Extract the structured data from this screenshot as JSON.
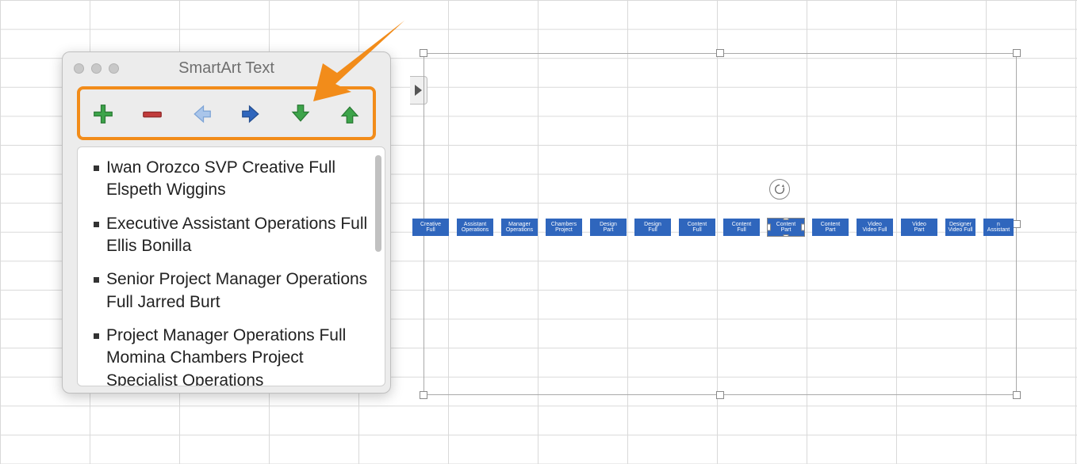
{
  "panel": {
    "title": "SmartArt Text",
    "toolbar": {
      "add": "add-shape",
      "remove": "remove-shape",
      "left": "promote-left",
      "right": "demote-right",
      "down": "move-down",
      "up": "move-up"
    },
    "items": [
      "Iwan Orozco  SVP Creative Full Elspeth Wiggins",
      "Executive Assistant Operations Full Ellis Bonilla",
      "Senior Project Manager Operations Full Jarred Burt",
      "Project Manager Operations Full Momina Chambers Project Specialist  Operations"
    ]
  },
  "colors": {
    "highlight": "#f28c1a",
    "node": "#2f66bd"
  },
  "smartart": {
    "selected_index": 8,
    "nodes": [
      {
        "l1": "Creative",
        "l2": "Full"
      },
      {
        "l1": "Assistant",
        "l2": "Operations"
      },
      {
        "l1": "Manager",
        "l2": "Operations"
      },
      {
        "l1": "Chambers",
        "l2": "Project"
      },
      {
        "l1": "Design",
        "l2": "Part"
      },
      {
        "l1": "Design",
        "l2": "Full"
      },
      {
        "l1": "Content",
        "l2": "Full"
      },
      {
        "l1": "Content",
        "l2": "Full"
      },
      {
        "l1": "Content",
        "l2": "Part"
      },
      {
        "l1": "Content",
        "l2": "Part"
      },
      {
        "l1": "Video",
        "l2": "Video Full"
      },
      {
        "l1": "Video",
        "l2": "Part"
      },
      {
        "l1": "Designer",
        "l2": "Video Full"
      },
      {
        "l1": "n",
        "l2": "Assistant"
      }
    ]
  }
}
